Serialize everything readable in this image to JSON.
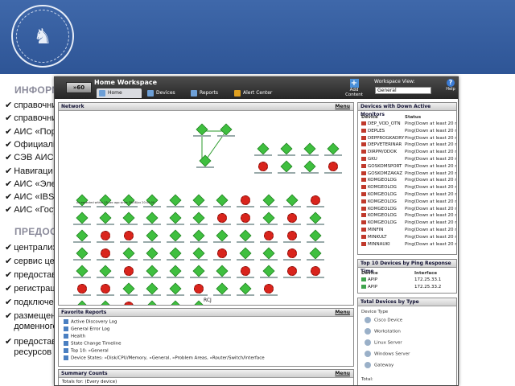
{
  "slide": {
    "heading1": "ИНФОРМ",
    "bullets1": [
      "справочни",
      "справочни",
      "АИС «Пор",
      "Официалі",
      "СЭВ АИС",
      "Навигаци",
      "АИС «Эле",
      "АИС «IBS N",
      "АИС «Госу"
    ],
    "heading2": "ПРЕДОСТ",
    "bullets2": [
      "централиз",
      "сервис цен",
      "предостав",
      "регистрац",
      "подключен",
      "размещен",
      "доменного",
      "предостав",
      "ресурсов ("
    ],
    "check": "✔"
  },
  "app": {
    "go": "»60",
    "workspace_title": "Home Workspace",
    "tabs": [
      "Home",
      "Devices",
      "Reports",
      "Alert Center"
    ],
    "add_content": "Add Content",
    "workspace_view_label": "Workspace View:",
    "workspace_view_value": "General",
    "help": "Help",
    "network": {
      "title": "Network",
      "menu": "Menu",
      "note": "As expected within 15 sec ago since 29/08/xx 20:00:00",
      "rcj": "RCJ"
    },
    "down_devices": {
      "title": "Devices with Down Active Monitors",
      "col_device": "Device",
      "col_status": "Status",
      "rows": [
        {
          "device": "DEP_VOD_OTN",
          "status": "Ping(Down at least 20 min)"
        },
        {
          "device": "DEPLES",
          "status": "Ping(Down at least 20 min)"
        },
        {
          "device": "DEPPROGKADRY",
          "status": "Ping(Down at least 20 min)"
        },
        {
          "device": "DEPVETERINAR",
          "status": "Ping(Down at least 20 min)"
        },
        {
          "device": "DIRPM/ODOK",
          "status": "Ping(Down at least 20 min)"
        },
        {
          "device": "GKU",
          "status": "Ping(Down at least 20 min)"
        },
        {
          "device": "GOSKOMSPORT",
          "status": "Ping(Down at least 20 min)"
        },
        {
          "device": "GOSKOMZAKAZ",
          "status": "Ping(Down at least 20 min)"
        },
        {
          "device": "KOMGEOLOG",
          "status": "Ping(Down at least 20 min)"
        },
        {
          "device": "KOMGEOLOG",
          "status": "Ping(Down at least 20 min)"
        },
        {
          "device": "KOMGEOLOG",
          "status": "Ping(Down at least 20 min)"
        },
        {
          "device": "KOMGEOLOG",
          "status": "Ping(Down at least 20 min)"
        },
        {
          "device": "KOMGEOLOG",
          "status": "Ping(Down at least 20 min)"
        },
        {
          "device": "KOMGEOLOG",
          "status": "Ping(Down at least 20 min)"
        },
        {
          "device": "KOMGEOLOG",
          "status": "Ping(Down at least 20 min)"
        },
        {
          "device": "MINFIN",
          "status": "Ping(Down at least 20 min)"
        },
        {
          "device": "MINKULT",
          "status": "Ping(Down at least 20 min)"
        },
        {
          "device": "MINNAUKI",
          "status": "Ping(Down at least 20 min)"
        }
      ]
    },
    "top10": {
      "title": "Top 10 Devices by Ping Response Time",
      "col_device": "Device",
      "col_interface": "Interface",
      "rows": [
        {
          "device": "APIP",
          "interface": "172.25.33.1"
        },
        {
          "device": "APIP",
          "interface": "172.25.33.2"
        }
      ]
    },
    "total_devices": {
      "title": "Total Devices by Type",
      "device_type": "Device Type",
      "types": [
        "Cisco Device",
        "Workstation",
        "Linux Server",
        "Windows Server",
        "Gateway"
      ],
      "total": "Total:"
    },
    "favorites": {
      "title": "Favorite Reports",
      "menu": "Menu",
      "items": [
        "Active Discovery Log",
        "General Error Log",
        "Health",
        "State Change Timeline",
        "Top 10: »General",
        "Device States: »Disk/CPU/Memory, »General, »Problem Areas, »Router/Switch/Interface"
      ]
    },
    "summary": {
      "title": "Summary Counts",
      "menu": "Menu",
      "totals_for": "Totals for: (Every device)"
    }
  }
}
